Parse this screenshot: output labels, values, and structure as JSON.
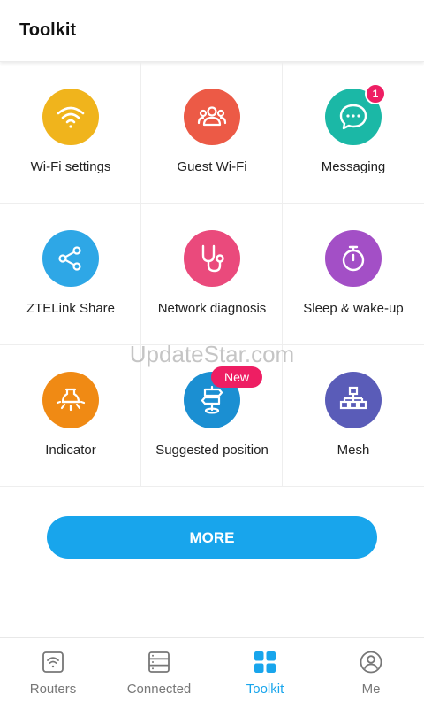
{
  "header": {
    "title": "Toolkit"
  },
  "tools": [
    {
      "label": "Wi-Fi settings",
      "icon": "wifi-icon",
      "color": "#f0b41c"
    },
    {
      "label": "Guest Wi-Fi",
      "icon": "guest-users-icon",
      "color": "#ec5a46"
    },
    {
      "label": "Messaging",
      "icon": "message-bubble-icon",
      "color": "#1bb8a6",
      "badge": "1"
    },
    {
      "label": "ZTELink Share",
      "icon": "share-icon",
      "color": "#2ea7e6"
    },
    {
      "label": "Network diagnosis",
      "icon": "stethoscope-icon",
      "color": "#ea4a7c"
    },
    {
      "label": "Sleep & wake-up",
      "icon": "stopwatch-icon",
      "color": "#a34fc6"
    },
    {
      "label": "Indicator",
      "icon": "light-bulb-icon",
      "color": "#f08a14"
    },
    {
      "label": "Suggested position",
      "icon": "signpost-icon",
      "color": "#1b8fd2",
      "badge": "New"
    },
    {
      "label": "Mesh",
      "icon": "network-tree-icon",
      "color": "#5a5cb8"
    }
  ],
  "watermark": "UpdateStar.com",
  "more_button": {
    "label": "MORE",
    "color": "#18a5ec"
  },
  "nav": {
    "active": "Toolkit",
    "items": [
      {
        "label": "Routers",
        "icon": "router-icon"
      },
      {
        "label": "Connected",
        "icon": "devices-icon"
      },
      {
        "label": "Toolkit",
        "icon": "grid-icon"
      },
      {
        "label": "Me",
        "icon": "user-circle-icon"
      }
    ]
  }
}
